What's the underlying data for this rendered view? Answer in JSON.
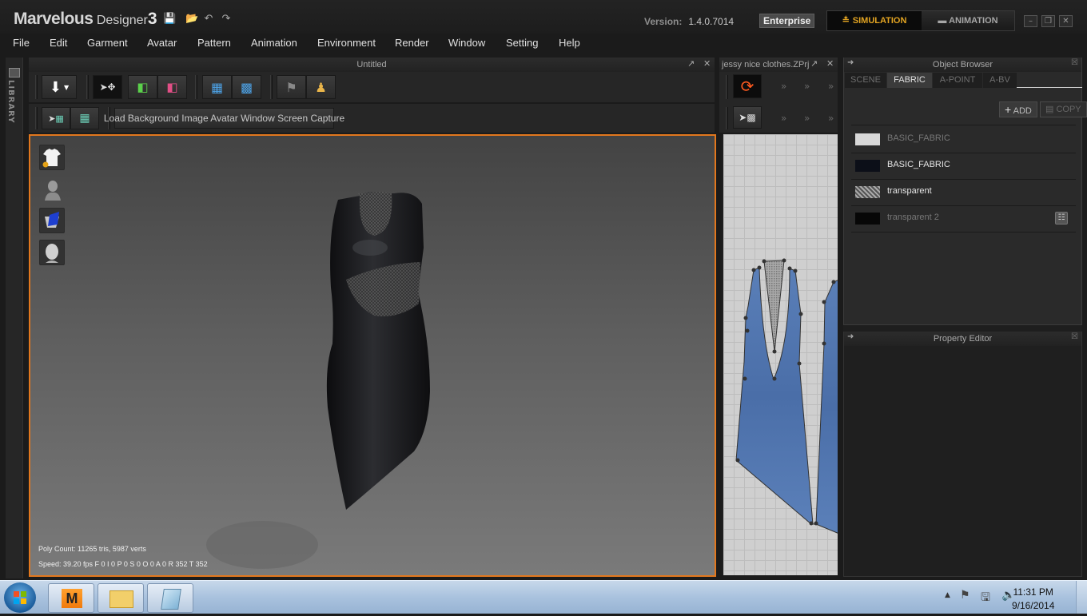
{
  "app": {
    "title_main": "Marvelous",
    "title_sub": "Designer",
    "title_num": "3",
    "version_label": "Version:",
    "version_value": "1.4.0.7014",
    "edition": "Enterprise",
    "modes": {
      "simulation": "SIMULATION",
      "animation": "ANIMATION",
      "active": "SIMULATION"
    },
    "accent_color": "#e2771d"
  },
  "menu": [
    "File",
    "Edit",
    "Garment",
    "Avatar",
    "Pattern",
    "Animation",
    "Environment",
    "Render",
    "Window",
    "Setting",
    "Help"
  ],
  "library_label": "LIBRARY",
  "viewport3d": {
    "title": "Untitled",
    "capture_button": "Load Background Image Avatar Window Screen Capture",
    "poly_count": "Poly Count: 11265 tris, 5987 verts",
    "speed": "Speed: 39.20 fps F  0 I  0 P  0 S  0 O  0 A  0 R 352 T 352"
  },
  "viewport2d": {
    "title": "jessy nice clothes.ZPrj"
  },
  "object_browser": {
    "title": "Object Browser",
    "tabs": [
      {
        "label": "SCENE",
        "active": false
      },
      {
        "label": "FABRIC",
        "active": true
      },
      {
        "label": "A-POINT",
        "active": false
      },
      {
        "label": "A-BV",
        "active": false
      }
    ],
    "add_label": "ADD",
    "copy_label": "COPY",
    "fabrics": [
      {
        "name": "BASIC_FABRIC",
        "swatch": "#d8d8d8",
        "dim": true
      },
      {
        "name": "BASIC_FABRIC",
        "swatch": "#0c0f18",
        "dim": false
      },
      {
        "name": "transparent",
        "swatch": "pattern",
        "dim": false
      },
      {
        "name": "transparent 2",
        "swatch": "#070707",
        "dim": true
      }
    ]
  },
  "property_editor": {
    "title": "Property Editor"
  },
  "taskbar": {
    "apps": [
      "Marvelous Designer",
      "Windows Explorer",
      "Notepad"
    ],
    "time": "11:31 PM",
    "date": "9/16/2014"
  }
}
